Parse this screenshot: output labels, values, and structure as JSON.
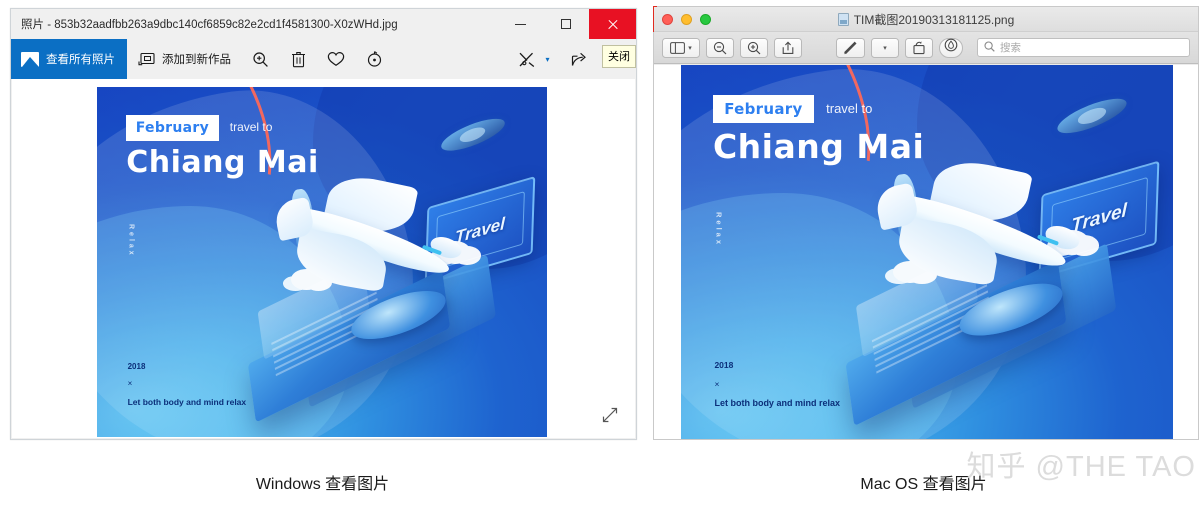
{
  "windows_viewer": {
    "titlebar": {
      "title": "照片 - 853b32aadfbb263a9dbc140cf6859c82e2cd1f4581300-X0zWHd.jpg",
      "minimize_label": "最小化",
      "maximize_label": "最大化",
      "close_label": "关闭"
    },
    "tooltip": {
      "text": "关闭"
    },
    "toolbar": {
      "view_all_photos": "查看所有照片",
      "add_to_creation": "添加到新作品",
      "zoom_icon": "magnifier-plus-icon",
      "delete_icon": "trash-icon",
      "favorite_icon": "heart-icon",
      "rotate_icon": "rotate-icon",
      "edit_icon": "edit-create-icon",
      "dropdown_icon": "chevron-down-icon",
      "share_icon": "share-icon",
      "more_label": "···"
    },
    "canvas": {
      "resize_icon": "expand-diagonal-icon"
    },
    "caption": "Windows  查看图片"
  },
  "mac_viewer": {
    "titlebar": {
      "title": "TIM截图20190313181125.png",
      "close_label": "close",
      "minimize_label": "minimize",
      "zoom_label": "zoom"
    },
    "toolbar": {
      "sidebar_icon": "sidebar-icon",
      "sidebar_caret": "chevron-down-icon",
      "zoom_out_icon": "magnifier-minus-icon",
      "zoom_in_icon": "magnifier-plus-icon",
      "share_icon": "share-up-icon",
      "markup_icon": "markup-pen-icon",
      "markup_caret": "chevron-down-icon",
      "rotate_icon": "rotate-left-icon",
      "annotate_icon": "annotate-icon",
      "search_icon": "search-icon",
      "search_placeholder": "搜索",
      "search_value": ""
    },
    "caption": "Mac OS  查看图片"
  },
  "poster": {
    "month": "February",
    "travel_to": "travel to",
    "city": "Chiang Mai",
    "relax_vertical": "Relax",
    "year": "2018",
    "separator": "×",
    "tagline": "Let both body and mind relax",
    "sign_label": "Travel",
    "colors": {
      "bg_deep_blue": "#1a4fc4",
      "bg_light_blue": "#6fd6f7",
      "accent_pink": "#f2685f",
      "month_text": "#2d7ff0",
      "dark_text": "#0b2f7a"
    }
  },
  "watermark": {
    "text": "知乎 @THE TAO"
  },
  "colors": {
    "windows_accent": "#0b6fc4",
    "windows_close_red": "#e81123",
    "mac_red": "#ff5f57",
    "mac_yellow": "#ffbd2e",
    "mac_green": "#28c840",
    "page_bg": "#ffffff"
  }
}
